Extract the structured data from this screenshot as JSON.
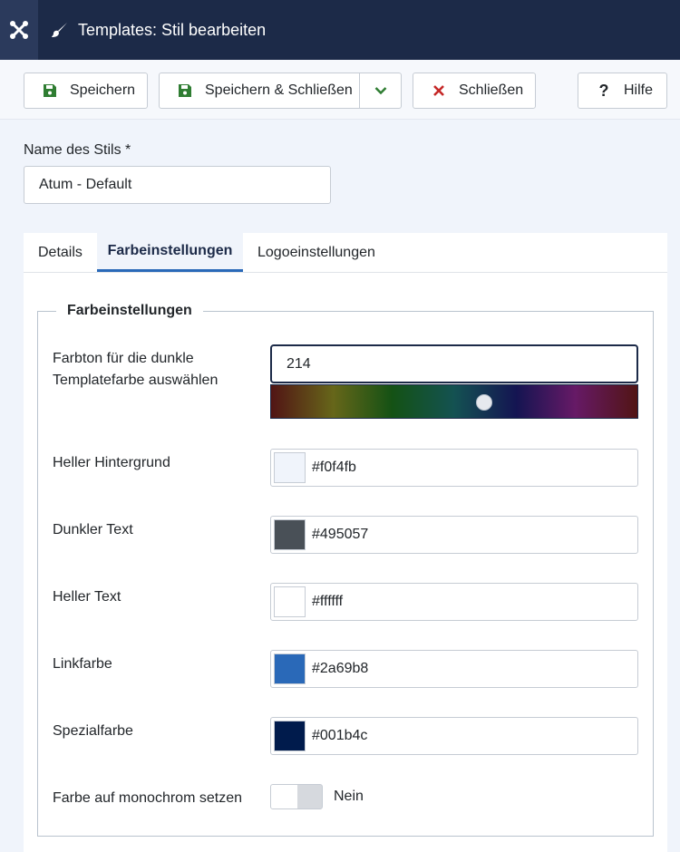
{
  "header": {
    "title": "Templates: Stil bearbeiten",
    "logo_icon": "joomla-logo-icon",
    "title_icon": "paint-brush-icon"
  },
  "toolbar": {
    "save_label": "Speichern",
    "save_close_label": "Speichern & Schließen",
    "close_label": "Schließen",
    "help_label": "Hilfe"
  },
  "style_name": {
    "label": "Name des Stils *",
    "value": "Atum - Default"
  },
  "tabs": [
    {
      "label": "Details",
      "active": false
    },
    {
      "label": "Farbeinstellungen",
      "active": true
    },
    {
      "label": "Logoeinstellungen",
      "active": false
    }
  ],
  "fieldset": {
    "legend": "Farbeinstellungen",
    "hue": {
      "label_line1": "Farbton für die dunkle",
      "label_line2": "Templatefarbe auswählen",
      "value": "214"
    },
    "colors": [
      {
        "label": "Heller Hintergrund",
        "value": "#f0f4fb",
        "swatch": "#f0f4fb"
      },
      {
        "label": "Dunkler Text",
        "value": "#495057",
        "swatch": "#495057"
      },
      {
        "label": "Heller Text",
        "value": "#ffffff",
        "swatch": "#ffffff"
      },
      {
        "label": "Linkfarbe",
        "value": "#2a69b8",
        "swatch": "#2a69b8"
      },
      {
        "label": "Spezialfarbe",
        "value": "#001b4c",
        "swatch": "#001b4c"
      }
    ],
    "monochrome": {
      "label": "Farbe auf monochrom setzen",
      "state": "Nein"
    }
  },
  "colors": {
    "header_bg": "#1c2a48",
    "page_bg": "#f0f4fb",
    "save_icon": "#2f7d32",
    "close_icon": "#c52827",
    "accent": "#2a69b8"
  }
}
